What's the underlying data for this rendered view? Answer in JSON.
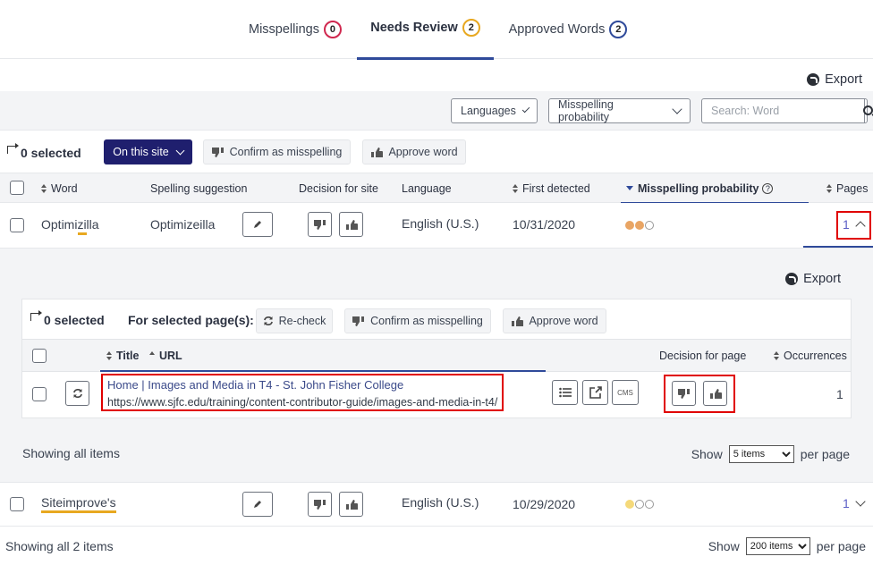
{
  "tabs": [
    {
      "label": "Misspellings",
      "count": "0",
      "color": "#d0284f"
    },
    {
      "label": "Needs Review",
      "count": "2",
      "color": "#e8a820",
      "active": true
    },
    {
      "label": "Approved Words",
      "count": "2",
      "color": "#2f4a9a"
    }
  ],
  "export_label": "Export",
  "filters": {
    "languages": "Languages",
    "probability": "Misspelling probability",
    "search_placeholder": "Search: Word"
  },
  "bulk": {
    "selected": "0 selected",
    "scope": "On this site",
    "confirm": "Confirm as misspelling",
    "approve": "Approve word"
  },
  "columns": {
    "word": "Word",
    "suggestion": "Spelling suggestion",
    "decision": "Decision for site",
    "language": "Language",
    "first_detected": "First detected",
    "probability": "Misspelling probability",
    "pages": "Pages"
  },
  "rows": [
    {
      "word": "Optimizilla",
      "suggestion": "Optimizeilla",
      "language": "English (U.S.)",
      "first_detected": "10/31/2020",
      "probability": "2 of 3",
      "pages": "1"
    },
    {
      "word": "Siteimprove's",
      "suggestion": "",
      "language": "English (U.S.)",
      "first_detected": "10/29/2020",
      "probability": "1 of 3",
      "pages": "1"
    }
  ],
  "sub": {
    "export_label": "Export",
    "selected": "0 selected",
    "for_selected": "For selected page(s):",
    "recheck": "Re-check",
    "confirm": "Confirm as misspelling",
    "approve": "Approve word",
    "col_title": "Title",
    "col_url": "URL",
    "col_decision": "Decision for page",
    "col_occurrences": "Occurrences",
    "page_title": "Home | Images and Media in T4 - St. John Fisher College",
    "page_url": "https://www.sjfc.edu/training/content-contributor-guide/images-and-media-in-t4/",
    "cms_label": "CMS",
    "occurrences": "1",
    "showing": "Showing all items",
    "show": "Show",
    "per_page_value": "5 items",
    "per_page": "per page"
  },
  "footer": {
    "showing": "Showing all 2 items",
    "show": "Show",
    "per_page_value": "200 items",
    "per_page": "per page"
  },
  "colors": {
    "primary": "#1f1f6e",
    "accent": "#2f4a9a",
    "underline": "#e8a820",
    "highlight_box": "#e00000"
  }
}
